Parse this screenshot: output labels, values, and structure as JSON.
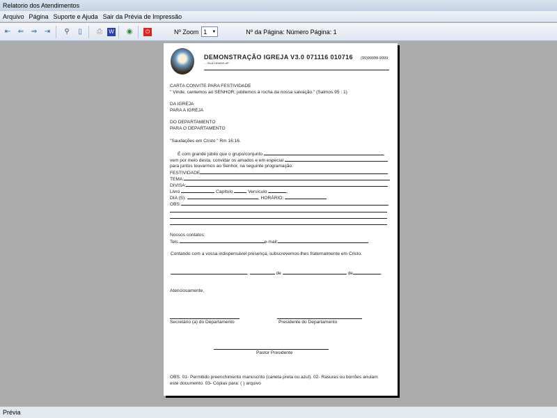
{
  "window": {
    "title": "Relatorio dos Atendimentos"
  },
  "menu": [
    "Arquivo",
    "Página",
    "Suporte e Ajuda",
    "Sair da Prévia de Impressão"
  ],
  "toolbar": {
    "zoom_label": "Nº Zoom",
    "zoom_value": "1",
    "page_label": "Nº da Página: Número Página: 1"
  },
  "doc": {
    "header_title": "DEMONSTRAÇÃO IGREJA V3.0 071116 010716",
    "header_sub": "- - SUA CIDADE-UF",
    "phone": "(99)99999-9999",
    "l1": "CARTA CONVITE PARA FESTIVIDADE",
    "l2": "\" Vinde, cantemos ao SENHOR; jubilemos à rocha da nossa salvação.\"   (Salmos 95 : 1)",
    "l3": "DA IGREJA",
    "l4": "PARA A IGREJA",
    "l5": "DO DEPARTAMENTO",
    "l6": "PARA O DEPARTAMENTO",
    "l7": "\"Saudações em Cristo \" Rm 16:16.",
    "l8": "É com grande júbilo que o grupo/conjunto",
    "l9": "vem por meio desta, convidar os amados e em especial",
    "l10": "para juntos louvarmos ao Senhor, na seguinte programação:",
    "festividade": "FESTIVIDADE",
    "tema": "TEMA:",
    "divisa": "DIVISA:",
    "livro": "Livro",
    "capitulo": "Capítulo",
    "versiculo": "Versículo",
    "dia": "DIA (S):",
    "horario": "HORÁRIO:",
    "obs": "OBS:",
    "contatos": "Nossos contatos:",
    "tels": "Tels.",
    "email": "e-mail:",
    "contando": "Contando com a vossa indispensável presença, subscrevemos-lhes fraternalmente em Cristo.",
    "de": "de",
    "atenciosamente": "Atenciosamente,",
    "secretario": "Secretário (a) do Departamento",
    "presidente": "Presidente do Departamento",
    "pastor": "Pastor Presidente",
    "obs1": "OBS. 01- Permitido preenchimento manuscrito (caneta preta ou azul). 02- Rasuras ou borrões anulam",
    "obs2": "este documento. 03- Cópias para: (   ) arquivo"
  },
  "status": "Prévia"
}
